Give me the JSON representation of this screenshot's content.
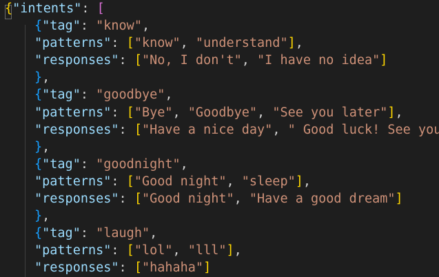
{
  "colors": {
    "background": "#1e1e1e",
    "key": "#9cdcfe",
    "string": "#ce9178",
    "punctuation": "#d4d4d4",
    "bracket_level_1": "#ffd700",
    "bracket_level_2": "#da70d6",
    "bracket_level_3": "#179fff"
  },
  "lines": [
    [
      [
        "brace0",
        "{"
      ],
      [
        "key",
        "\"intents\""
      ],
      [
        "punc",
        ": "
      ],
      [
        "brace1",
        "["
      ]
    ],
    [
      [
        "brace2",
        "{"
      ],
      [
        "key",
        "\"tag\""
      ],
      [
        "punc",
        ": "
      ],
      [
        "str",
        "\"know\""
      ],
      [
        "punc",
        ","
      ]
    ],
    [
      [
        "key",
        "\"patterns\""
      ],
      [
        "punc",
        ": "
      ],
      [
        "brace0",
        "["
      ],
      [
        "str",
        "\"know\""
      ],
      [
        "punc",
        ", "
      ],
      [
        "str",
        "\"understand\""
      ],
      [
        "brace0",
        "]"
      ],
      [
        "punc",
        ","
      ]
    ],
    [
      [
        "key",
        "\"responses\""
      ],
      [
        "punc",
        ": "
      ],
      [
        "brace0",
        "["
      ],
      [
        "str",
        "\"No, I don't\""
      ],
      [
        "punc",
        ", "
      ],
      [
        "str",
        "\"I have no idea\""
      ],
      [
        "brace0",
        "]"
      ]
    ],
    [
      [
        "brace2",
        "}"
      ],
      [
        "punc",
        ","
      ]
    ],
    [
      [
        "brace2",
        "{"
      ],
      [
        "key",
        "\"tag\""
      ],
      [
        "punc",
        ": "
      ],
      [
        "str",
        "\"goodbye\""
      ],
      [
        "punc",
        ","
      ]
    ],
    [
      [
        "key",
        "\"patterns\""
      ],
      [
        "punc",
        ": "
      ],
      [
        "brace0",
        "["
      ],
      [
        "str",
        "\"Bye\""
      ],
      [
        "punc",
        ", "
      ],
      [
        "str",
        "\"Goodbye\""
      ],
      [
        "punc",
        ", "
      ],
      [
        "str",
        "\"See you later\""
      ],
      [
        "brace0",
        "]"
      ],
      [
        "punc",
        ","
      ]
    ],
    [
      [
        "key",
        "\"responses\""
      ],
      [
        "punc",
        ": "
      ],
      [
        "brace0",
        "["
      ],
      [
        "str",
        "\"Have a nice day\""
      ],
      [
        "punc",
        ", "
      ],
      [
        "str",
        "\" Good luck! See you!\""
      ],
      [
        "brace0",
        "]"
      ]
    ],
    [
      [
        "brace2",
        "}"
      ],
      [
        "punc",
        ","
      ]
    ],
    [
      [
        "brace2",
        "{"
      ],
      [
        "key",
        "\"tag\""
      ],
      [
        "punc",
        ": "
      ],
      [
        "str",
        "\"goodnight\""
      ],
      [
        "punc",
        ","
      ]
    ],
    [
      [
        "key",
        "\"patterns\""
      ],
      [
        "punc",
        ": "
      ],
      [
        "brace0",
        "["
      ],
      [
        "str",
        "\"Good night\""
      ],
      [
        "punc",
        ", "
      ],
      [
        "str",
        "\"sleep\""
      ],
      [
        "brace0",
        "]"
      ],
      [
        "punc",
        ","
      ]
    ],
    [
      [
        "key",
        "\"responses\""
      ],
      [
        "punc",
        ": "
      ],
      [
        "brace0",
        "["
      ],
      [
        "str",
        "\"Good night\""
      ],
      [
        "punc",
        ", "
      ],
      [
        "str",
        "\"Have a good dream\""
      ],
      [
        "brace0",
        "]"
      ]
    ],
    [
      [
        "brace2",
        "}"
      ],
      [
        "punc",
        ","
      ]
    ],
    [
      [
        "brace2",
        "{"
      ],
      [
        "key",
        "\"tag\""
      ],
      [
        "punc",
        ": "
      ],
      [
        "str",
        "\"laugh\""
      ],
      [
        "punc",
        ","
      ]
    ],
    [
      [
        "key",
        "\"patterns\""
      ],
      [
        "punc",
        ": "
      ],
      [
        "brace0",
        "["
      ],
      [
        "str",
        "\"lol\""
      ],
      [
        "punc",
        ", "
      ],
      [
        "str",
        "\"lll\""
      ],
      [
        "brace0",
        "]"
      ],
      [
        "punc",
        ","
      ]
    ],
    [
      [
        "key",
        "\"responses\""
      ],
      [
        "punc",
        ": "
      ],
      [
        "brace0",
        "["
      ],
      [
        "str",
        "\"hahaha\""
      ],
      [
        "brace0",
        "]"
      ]
    ]
  ]
}
